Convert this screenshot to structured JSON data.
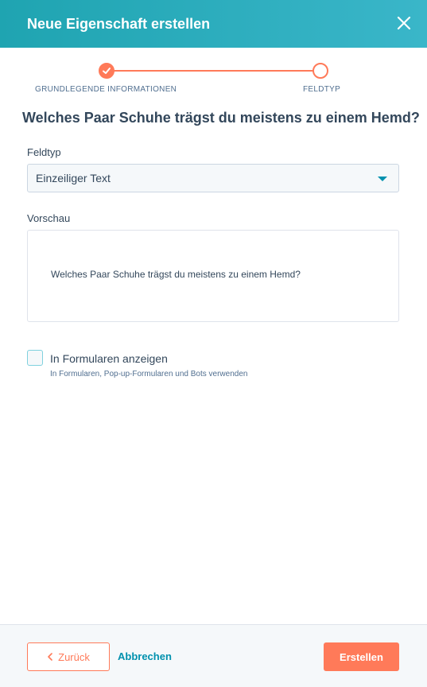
{
  "dialog": {
    "title": "Neue Eigenschaft erstellen"
  },
  "stepper": {
    "steps": [
      {
        "label": "GRUNDLEGENDE INFORMATIONEN",
        "status": "done"
      },
      {
        "label": "FELDTYP",
        "status": "current"
      }
    ]
  },
  "main": {
    "question": "Welches Paar Schuhe trägst du meistens zu einem Hemd?",
    "field_type_label": "Feldtyp",
    "field_type_value": "Einzeiliger Text",
    "preview_label": "Vorschau",
    "preview_text": "Welches Paar Schuhe trägst du meistens zu einem Hemd?",
    "show_in_forms": {
      "label": "In Formularen anzeigen",
      "help": "In Formularen, Pop-up-Formularen und Bots verwenden",
      "checked": false
    }
  },
  "footer": {
    "back_label": "Zurück",
    "cancel_label": "Abbrechen",
    "create_label": "Erstellen"
  },
  "colors": {
    "header": "#1fa4b1",
    "accent": "#ff7a59",
    "link": "#0091ae"
  }
}
